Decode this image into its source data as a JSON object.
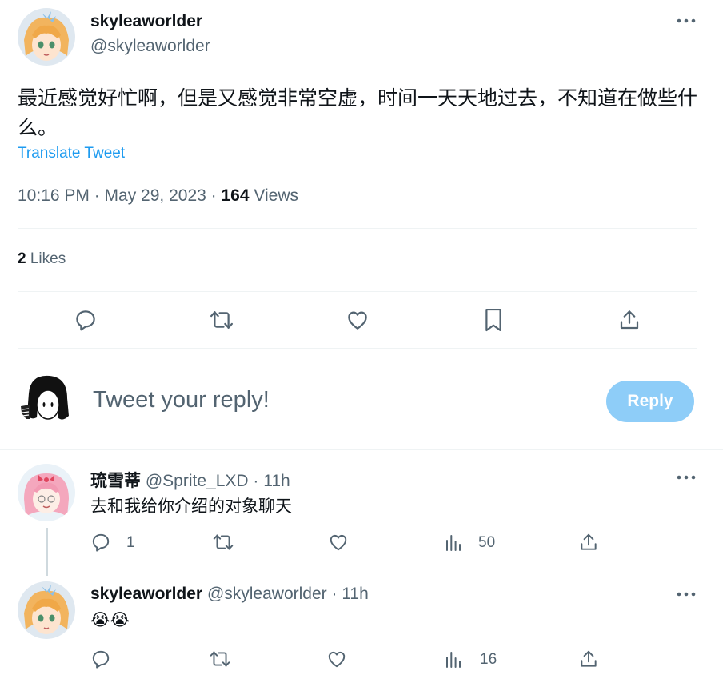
{
  "main_tweet": {
    "author_name": "skyleaworlder",
    "author_handle": "@skyleaworlder",
    "text": "最近感觉好忙啊，但是又感觉非常空虚，时间一天天地过去，不知道在做些什么。",
    "translate_label": "Translate Tweet",
    "timestamp": "10:16 PM · May 29, 2023 · ",
    "views_count": "164",
    "views_label": " Views",
    "likes_count": "2",
    "likes_label": " Likes"
  },
  "composer": {
    "placeholder": "Tweet your reply!",
    "reply_button": "Reply"
  },
  "replies": [
    {
      "author_name": "琉雪蒂",
      "author_handle": "@Sprite_LXD",
      "separator": " · ",
      "time": "11h",
      "text": "去和我给你介绍的对象聊天",
      "reply_count": "1",
      "views": "50"
    },
    {
      "author_name": "skyleaworlder",
      "author_handle": "@skyleaworlder",
      "separator": " · ",
      "time": "11h",
      "text": "😭😭",
      "reply_count": "",
      "views": "16"
    }
  ],
  "icons": [
    "more-icon",
    "reply-icon",
    "retweet-icon",
    "like-icon",
    "bookmark-icon",
    "share-icon",
    "views-icon"
  ],
  "colors": {
    "accent": "#1d9bf0",
    "reply_button_disabled": "#8ecdf8",
    "secondary_text": "#536471",
    "divider": "#eff3f4",
    "icon": "#536471"
  }
}
